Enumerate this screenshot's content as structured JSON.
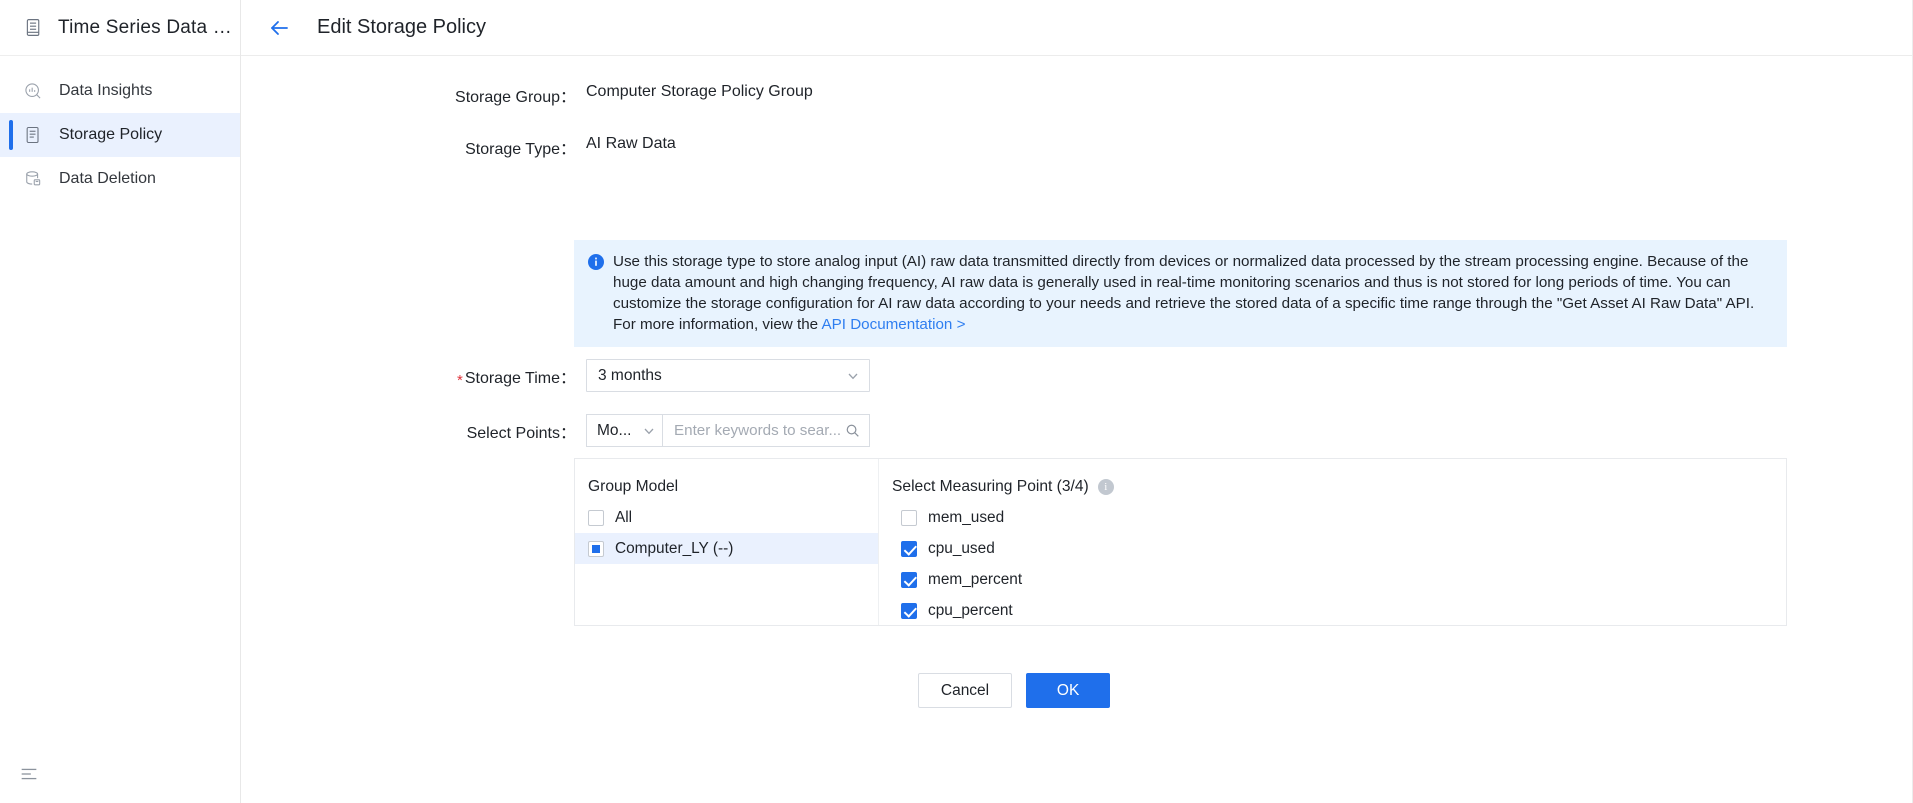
{
  "sidebar": {
    "brand": {
      "title": "Time Series Data …",
      "icon": "database-server-icon"
    },
    "items": [
      {
        "label": "Data Insights",
        "icon": "data-insights-icon",
        "active": false
      },
      {
        "label": "Storage Policy",
        "icon": "storage-policy-icon",
        "active": true
      },
      {
        "label": "Data Deletion",
        "icon": "data-deletion-icon",
        "active": false
      }
    ],
    "collapse_icon": "collapse-menu-icon"
  },
  "topbar": {
    "back_icon": "back-arrow-icon",
    "title": "Edit Storage Policy"
  },
  "form": {
    "storage_group": {
      "label": "Storage Group：",
      "value": "Computer Storage Policy Group"
    },
    "storage_type": {
      "label": "Storage Type：",
      "value": "AI Raw Data"
    },
    "info": {
      "icon": "info-circle-icon",
      "text": "Use this storage type to store analog input (AI) raw data transmitted directly from devices or normalized data processed by the stream processing engine. Because of the huge data amount and high changing frequency, AI raw data is generally used in real-time monitoring scenarios and thus is not stored for long periods of time. You can customize the storage configuration for AI raw data according to your needs and retrieve the stored data of a specific time range through the \"Get Asset AI Raw Data\" API. For more information, view the ",
      "link_text": "API Documentation >"
    },
    "storage_time": {
      "label": "Storage Time：",
      "required": true,
      "value": "3 months",
      "chevron_icon": "chevron-down-icon"
    },
    "select_points": {
      "label": "Select Points：",
      "mode_value": "Mo...",
      "mode_chevron_icon": "chevron-down-icon",
      "search_placeholder": "Enter keywords to sear...",
      "search_value": "",
      "search_icon": "search-icon"
    }
  },
  "panel": {
    "left": {
      "header": "Group Model",
      "options": [
        {
          "label": "All",
          "state": "unchecked",
          "selected": false
        },
        {
          "label": "Computer_LY (--)",
          "state": "indeterminate",
          "selected": true
        }
      ]
    },
    "right": {
      "header": "Select Measuring Point (3/4)",
      "help_icon": "info-help-icon",
      "help_glyph": "i",
      "options": [
        {
          "label": "mem_used",
          "state": "unchecked"
        },
        {
          "label": "cpu_used",
          "state": "checked"
        },
        {
          "label": "mem_percent",
          "state": "checked"
        },
        {
          "label": "cpu_percent",
          "state": "checked"
        }
      ]
    }
  },
  "footer": {
    "cancel_label": "Cancel",
    "ok_label": "OK"
  },
  "colors": {
    "accent": "#1f6feb",
    "info_bg": "#e8f3fe",
    "selected_bg": "#eaf1fe",
    "required_star": "#e0343c",
    "link": "#2f7ef0"
  }
}
